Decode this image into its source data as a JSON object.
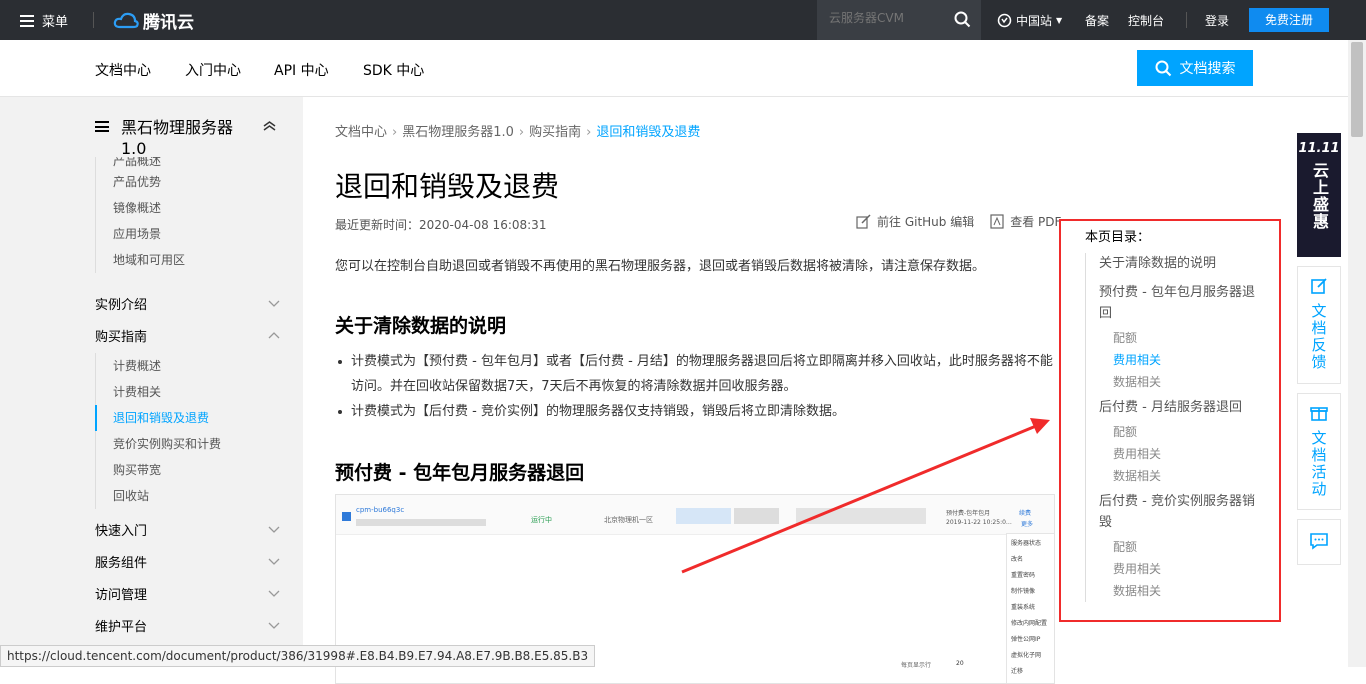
{
  "topbar": {
    "menu_label": "菜单",
    "logo_text": "腾讯云",
    "search_placeholder": "云服务器CVM",
    "site_selector": "中国站",
    "links": [
      "备案",
      "控制台",
      "登录"
    ],
    "signup": "免费注册"
  },
  "subnav": {
    "items": [
      "文档中心",
      "入门中心",
      "API 中心",
      "SDK 中心"
    ],
    "doc_search": "文档搜索"
  },
  "sidebar": {
    "product_title": "黑石物理服务器 1.0",
    "intro_items": [
      "产品概述",
      "产品优势",
      "镜像概述",
      "应用场景",
      "地域和可用区"
    ],
    "categories_top": [
      "实例介绍",
      "购买指南"
    ],
    "purchase_items": [
      "计费概述",
      "计费相关",
      "退回和销毁及退费",
      "竞价实例购买和计费",
      "购买带宽",
      "回收站"
    ],
    "categories_bottom": [
      "快速入门",
      "服务组件",
      "访问管理",
      "维护平台"
    ]
  },
  "breadcrumb": [
    "文档中心",
    "黑石物理服务器1.0",
    "购买指南",
    "退回和销毁及退费"
  ],
  "page": {
    "title": "退回和销毁及退费",
    "updated": "最近更新时间：2020-04-08 16:08:31",
    "github_edit": "前往 GitHub 编辑",
    "view_pdf": "查看 PDF",
    "intro": "您可以在控制台自助退回或者销毁不再使用的黑石物理服务器，退回或者销毁后数据将被清除，请注意保存数据。",
    "section1": "关于清除数据的说明",
    "bullets": [
      "计费模式为【预付费 - 包年包月】或者【后付费 - 月结】的物理服务器退回后将立即隔离并移入回收站，此时服务器将不能访问。并在回收站保留数据7天，7天后不再恢复的将清除数据并回收服务器。",
      "计费模式为【后付费 - 竞价实例】的物理服务器仅支持销毁，销毁后将立即清除数据。"
    ],
    "section2": "预付费 - 包年包月服务器退回"
  },
  "screenshot_mock": {
    "instance_id": "cpm-bu66q3c",
    "status": "运行中",
    "zone": "北京物理机一区",
    "billing": "预付费-包年包月",
    "billing_date": "2019-11-22 10:25:0…",
    "renew": "续费",
    "more": "更多",
    "menu_items": [
      "服务器状态",
      "改名",
      "重置密码",
      "制作镜像",
      "重装系统",
      "修改内网配置",
      "弹性公网IP",
      "虚拟化子网",
      "迁移"
    ],
    "per_page_label": "每页显示行",
    "per_page_value": "20"
  },
  "toc": {
    "title": "本页目录：",
    "entries": [
      {
        "heading": "关于清除数据的说明",
        "subs": []
      },
      {
        "heading": "预付费 - 包年包月服务器退回",
        "subs": [
          "配额",
          "费用相关",
          "数据相关"
        ]
      },
      {
        "heading": "后付费 - 月结服务器退回",
        "subs": [
          "配额",
          "费用相关",
          "数据相关"
        ]
      },
      {
        "heading": "后付费 - 竞价实例服务器销毁",
        "subs": [
          "配额",
          "费用相关",
          "数据相关"
        ]
      }
    ],
    "active_sub": "费用相关"
  },
  "floating": {
    "promo_top": "11.11",
    "promo_text": "云上盛惠",
    "feedback": "文档反馈",
    "activity": "文档活动"
  },
  "status_url": "https://cloud.tencent.com/document/product/386/31998#.E8.B4.B9.E7.94.A8.E7.9B.B8.E5.85.B3",
  "colors": {
    "accent": "#00a4ff",
    "topbar": "#2b2e33",
    "signup": "#0f8bf0",
    "annotation_red": "#f02b2b"
  }
}
